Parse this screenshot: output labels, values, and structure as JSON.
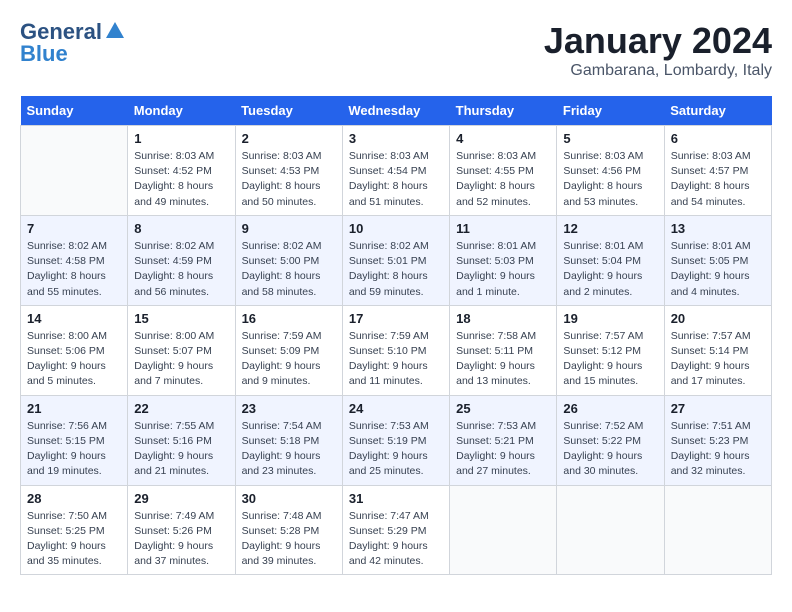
{
  "header": {
    "logo_line1": "General",
    "logo_line2": "Blue",
    "month": "January 2024",
    "location": "Gambarana, Lombardy, Italy"
  },
  "weekdays": [
    "Sunday",
    "Monday",
    "Tuesday",
    "Wednesday",
    "Thursday",
    "Friday",
    "Saturday"
  ],
  "weeks": [
    [
      {
        "day": "",
        "info": ""
      },
      {
        "day": "1",
        "info": "Sunrise: 8:03 AM\nSunset: 4:52 PM\nDaylight: 8 hours\nand 49 minutes."
      },
      {
        "day": "2",
        "info": "Sunrise: 8:03 AM\nSunset: 4:53 PM\nDaylight: 8 hours\nand 50 minutes."
      },
      {
        "day": "3",
        "info": "Sunrise: 8:03 AM\nSunset: 4:54 PM\nDaylight: 8 hours\nand 51 minutes."
      },
      {
        "day": "4",
        "info": "Sunrise: 8:03 AM\nSunset: 4:55 PM\nDaylight: 8 hours\nand 52 minutes."
      },
      {
        "day": "5",
        "info": "Sunrise: 8:03 AM\nSunset: 4:56 PM\nDaylight: 8 hours\nand 53 minutes."
      },
      {
        "day": "6",
        "info": "Sunrise: 8:03 AM\nSunset: 4:57 PM\nDaylight: 8 hours\nand 54 minutes."
      }
    ],
    [
      {
        "day": "7",
        "info": "Sunrise: 8:02 AM\nSunset: 4:58 PM\nDaylight: 8 hours\nand 55 minutes."
      },
      {
        "day": "8",
        "info": "Sunrise: 8:02 AM\nSunset: 4:59 PM\nDaylight: 8 hours\nand 56 minutes."
      },
      {
        "day": "9",
        "info": "Sunrise: 8:02 AM\nSunset: 5:00 PM\nDaylight: 8 hours\nand 58 minutes."
      },
      {
        "day": "10",
        "info": "Sunrise: 8:02 AM\nSunset: 5:01 PM\nDaylight: 8 hours\nand 59 minutes."
      },
      {
        "day": "11",
        "info": "Sunrise: 8:01 AM\nSunset: 5:03 PM\nDaylight: 9 hours\nand 1 minute."
      },
      {
        "day": "12",
        "info": "Sunrise: 8:01 AM\nSunset: 5:04 PM\nDaylight: 9 hours\nand 2 minutes."
      },
      {
        "day": "13",
        "info": "Sunrise: 8:01 AM\nSunset: 5:05 PM\nDaylight: 9 hours\nand 4 minutes."
      }
    ],
    [
      {
        "day": "14",
        "info": "Sunrise: 8:00 AM\nSunset: 5:06 PM\nDaylight: 9 hours\nand 5 minutes."
      },
      {
        "day": "15",
        "info": "Sunrise: 8:00 AM\nSunset: 5:07 PM\nDaylight: 9 hours\nand 7 minutes."
      },
      {
        "day": "16",
        "info": "Sunrise: 7:59 AM\nSunset: 5:09 PM\nDaylight: 9 hours\nand 9 minutes."
      },
      {
        "day": "17",
        "info": "Sunrise: 7:59 AM\nSunset: 5:10 PM\nDaylight: 9 hours\nand 11 minutes."
      },
      {
        "day": "18",
        "info": "Sunrise: 7:58 AM\nSunset: 5:11 PM\nDaylight: 9 hours\nand 13 minutes."
      },
      {
        "day": "19",
        "info": "Sunrise: 7:57 AM\nSunset: 5:12 PM\nDaylight: 9 hours\nand 15 minutes."
      },
      {
        "day": "20",
        "info": "Sunrise: 7:57 AM\nSunset: 5:14 PM\nDaylight: 9 hours\nand 17 minutes."
      }
    ],
    [
      {
        "day": "21",
        "info": "Sunrise: 7:56 AM\nSunset: 5:15 PM\nDaylight: 9 hours\nand 19 minutes."
      },
      {
        "day": "22",
        "info": "Sunrise: 7:55 AM\nSunset: 5:16 PM\nDaylight: 9 hours\nand 21 minutes."
      },
      {
        "day": "23",
        "info": "Sunrise: 7:54 AM\nSunset: 5:18 PM\nDaylight: 9 hours\nand 23 minutes."
      },
      {
        "day": "24",
        "info": "Sunrise: 7:53 AM\nSunset: 5:19 PM\nDaylight: 9 hours\nand 25 minutes."
      },
      {
        "day": "25",
        "info": "Sunrise: 7:53 AM\nSunset: 5:21 PM\nDaylight: 9 hours\nand 27 minutes."
      },
      {
        "day": "26",
        "info": "Sunrise: 7:52 AM\nSunset: 5:22 PM\nDaylight: 9 hours\nand 30 minutes."
      },
      {
        "day": "27",
        "info": "Sunrise: 7:51 AM\nSunset: 5:23 PM\nDaylight: 9 hours\nand 32 minutes."
      }
    ],
    [
      {
        "day": "28",
        "info": "Sunrise: 7:50 AM\nSunset: 5:25 PM\nDaylight: 9 hours\nand 35 minutes."
      },
      {
        "day": "29",
        "info": "Sunrise: 7:49 AM\nSunset: 5:26 PM\nDaylight: 9 hours\nand 37 minutes."
      },
      {
        "day": "30",
        "info": "Sunrise: 7:48 AM\nSunset: 5:28 PM\nDaylight: 9 hours\nand 39 minutes."
      },
      {
        "day": "31",
        "info": "Sunrise: 7:47 AM\nSunset: 5:29 PM\nDaylight: 9 hours\nand 42 minutes."
      },
      {
        "day": "",
        "info": ""
      },
      {
        "day": "",
        "info": ""
      },
      {
        "day": "",
        "info": ""
      }
    ]
  ]
}
